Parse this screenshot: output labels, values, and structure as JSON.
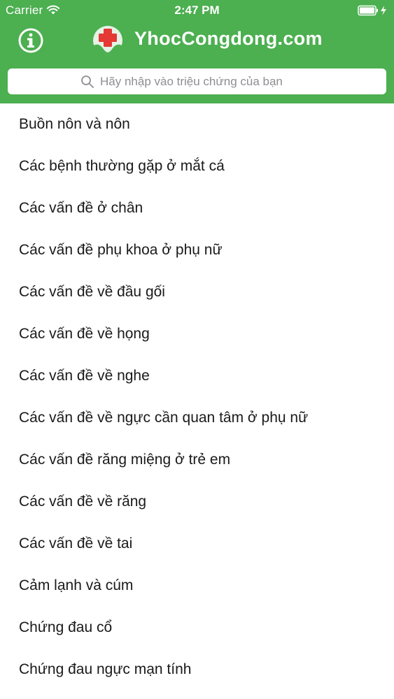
{
  "status_bar": {
    "carrier": "Carrier",
    "time": "2:47 PM"
  },
  "nav": {
    "title": "YhocCongdong.com",
    "info_icon": "info-circle-icon",
    "logo_icon": "medical-cross-hands-logo"
  },
  "search": {
    "placeholder": "Hãy nhập vào triệu chứng của bạn",
    "value": ""
  },
  "symptoms": [
    "Buồn nôn và nôn",
    "Các bệnh thường gặp ở mắt cá",
    "Các vấn đề ở chân",
    "Các vấn đề phụ khoa ở phụ nữ",
    "Các vấn đề về đầu gối",
    "Các vấn đề về họng",
    "Các vấn đề về nghe",
    "Các vấn đề về ngực cần quan tâm ở phụ nữ",
    "Các vấn đề răng miệng ở trẻ em",
    "Các vấn đề về răng",
    "Các vấn đề về tai",
    "Cảm lạnh và cúm",
    "Chứng đau cổ",
    "Chứng đau ngực mạn tính"
  ],
  "colors": {
    "header_green": "#4caf50",
    "logo_red": "#e53935",
    "text": "#1a1a1a"
  }
}
